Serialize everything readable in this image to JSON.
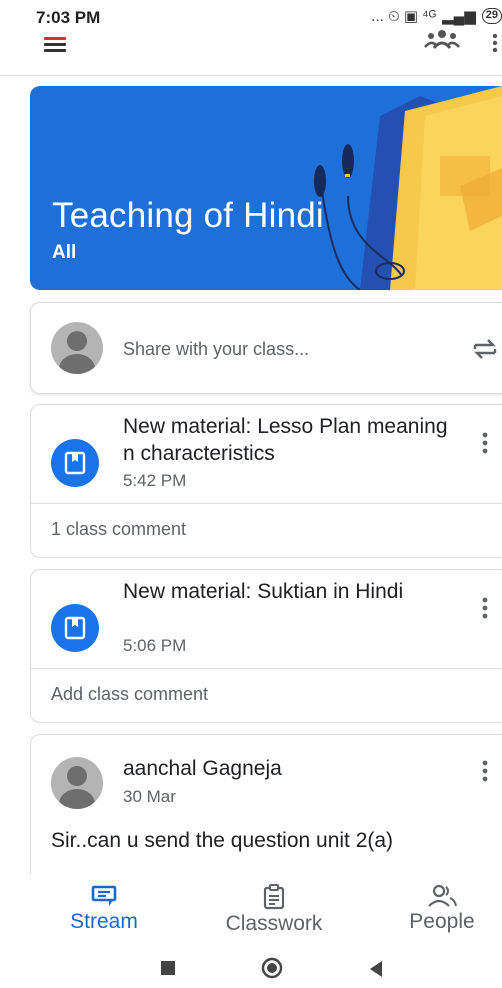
{
  "status_bar": {
    "time": "7:03 PM",
    "indicators": "... ⏲ ▣ ⁴ᴳ",
    "battery": "29"
  },
  "app_bar": {
    "menu_icon": "menu-icon",
    "people_icon": "people-icon",
    "more_icon": "more-vert-icon"
  },
  "banner": {
    "title": "Teaching of Hindi",
    "subtitle": "All",
    "color": "#1f6fd8"
  },
  "share": {
    "placeholder": "Share with your class..."
  },
  "stream": [
    {
      "title": "New material: Lesso Plan meaning n characteristics",
      "time": "5:42 PM",
      "comment": "1 class comment"
    },
    {
      "title": "New material: Suktian in Hindi",
      "time": "5:06 PM",
      "comment": "Add class comment"
    }
  ],
  "post": {
    "author": "aanchal Gagneja",
    "date": "30 Mar",
    "body": "Sir..can u send the question unit 2(a)"
  },
  "bottom_nav": {
    "stream": "Stream",
    "classwork": "Classwork",
    "people": "People",
    "active_color": "#1967d2"
  }
}
